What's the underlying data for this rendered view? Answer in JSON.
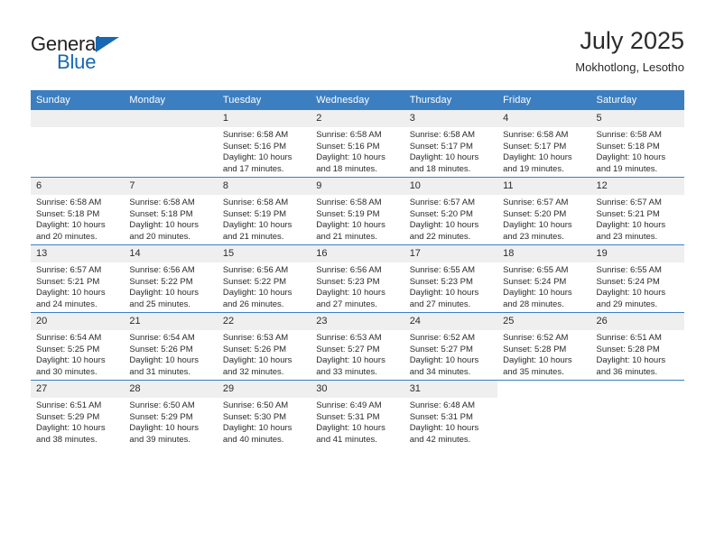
{
  "logo": {
    "word_primary": "General",
    "word_secondary": "Blue",
    "triangle_color": "#1668b3"
  },
  "header": {
    "title": "July 2025",
    "location": "Mokhotlong, Lesotho"
  },
  "theme": {
    "header_blue": "#3c7fc1",
    "daynum_gray": "#efefef",
    "text": "#2b2b2b"
  },
  "calendar": {
    "weekday_headers": [
      "Sunday",
      "Monday",
      "Tuesday",
      "Wednesday",
      "Thursday",
      "Friday",
      "Saturday"
    ],
    "labels": {
      "sunrise": "Sunrise:",
      "sunset": "Sunset:",
      "daylight": "Daylight:"
    },
    "weeks": [
      [
        {
          "day": "",
          "sunrise": "",
          "sunset": "",
          "daylight": "",
          "empty": true
        },
        {
          "day": "",
          "sunrise": "",
          "sunset": "",
          "daylight": "",
          "empty": true
        },
        {
          "day": "1",
          "sunrise": "Sunrise: 6:58 AM",
          "sunset": "Sunset: 5:16 PM",
          "daylight": "Daylight: 10 hours and 17 minutes."
        },
        {
          "day": "2",
          "sunrise": "Sunrise: 6:58 AM",
          "sunset": "Sunset: 5:16 PM",
          "daylight": "Daylight: 10 hours and 18 minutes."
        },
        {
          "day": "3",
          "sunrise": "Sunrise: 6:58 AM",
          "sunset": "Sunset: 5:17 PM",
          "daylight": "Daylight: 10 hours and 18 minutes."
        },
        {
          "day": "4",
          "sunrise": "Sunrise: 6:58 AM",
          "sunset": "Sunset: 5:17 PM",
          "daylight": "Daylight: 10 hours and 19 minutes."
        },
        {
          "day": "5",
          "sunrise": "Sunrise: 6:58 AM",
          "sunset": "Sunset: 5:18 PM",
          "daylight": "Daylight: 10 hours and 19 minutes."
        }
      ],
      [
        {
          "day": "6",
          "sunrise": "Sunrise: 6:58 AM",
          "sunset": "Sunset: 5:18 PM",
          "daylight": "Daylight: 10 hours and 20 minutes."
        },
        {
          "day": "7",
          "sunrise": "Sunrise: 6:58 AM",
          "sunset": "Sunset: 5:18 PM",
          "daylight": "Daylight: 10 hours and 20 minutes."
        },
        {
          "day": "8",
          "sunrise": "Sunrise: 6:58 AM",
          "sunset": "Sunset: 5:19 PM",
          "daylight": "Daylight: 10 hours and 21 minutes."
        },
        {
          "day": "9",
          "sunrise": "Sunrise: 6:58 AM",
          "sunset": "Sunset: 5:19 PM",
          "daylight": "Daylight: 10 hours and 21 minutes."
        },
        {
          "day": "10",
          "sunrise": "Sunrise: 6:57 AM",
          "sunset": "Sunset: 5:20 PM",
          "daylight": "Daylight: 10 hours and 22 minutes."
        },
        {
          "day": "11",
          "sunrise": "Sunrise: 6:57 AM",
          "sunset": "Sunset: 5:20 PM",
          "daylight": "Daylight: 10 hours and 23 minutes."
        },
        {
          "day": "12",
          "sunrise": "Sunrise: 6:57 AM",
          "sunset": "Sunset: 5:21 PM",
          "daylight": "Daylight: 10 hours and 23 minutes."
        }
      ],
      [
        {
          "day": "13",
          "sunrise": "Sunrise: 6:57 AM",
          "sunset": "Sunset: 5:21 PM",
          "daylight": "Daylight: 10 hours and 24 minutes."
        },
        {
          "day": "14",
          "sunrise": "Sunrise: 6:56 AM",
          "sunset": "Sunset: 5:22 PM",
          "daylight": "Daylight: 10 hours and 25 minutes."
        },
        {
          "day": "15",
          "sunrise": "Sunrise: 6:56 AM",
          "sunset": "Sunset: 5:22 PM",
          "daylight": "Daylight: 10 hours and 26 minutes."
        },
        {
          "day": "16",
          "sunrise": "Sunrise: 6:56 AM",
          "sunset": "Sunset: 5:23 PM",
          "daylight": "Daylight: 10 hours and 27 minutes."
        },
        {
          "day": "17",
          "sunrise": "Sunrise: 6:55 AM",
          "sunset": "Sunset: 5:23 PM",
          "daylight": "Daylight: 10 hours and 27 minutes."
        },
        {
          "day": "18",
          "sunrise": "Sunrise: 6:55 AM",
          "sunset": "Sunset: 5:24 PM",
          "daylight": "Daylight: 10 hours and 28 minutes."
        },
        {
          "day": "19",
          "sunrise": "Sunrise: 6:55 AM",
          "sunset": "Sunset: 5:24 PM",
          "daylight": "Daylight: 10 hours and 29 minutes."
        }
      ],
      [
        {
          "day": "20",
          "sunrise": "Sunrise: 6:54 AM",
          "sunset": "Sunset: 5:25 PM",
          "daylight": "Daylight: 10 hours and 30 minutes."
        },
        {
          "day": "21",
          "sunrise": "Sunrise: 6:54 AM",
          "sunset": "Sunset: 5:26 PM",
          "daylight": "Daylight: 10 hours and 31 minutes."
        },
        {
          "day": "22",
          "sunrise": "Sunrise: 6:53 AM",
          "sunset": "Sunset: 5:26 PM",
          "daylight": "Daylight: 10 hours and 32 minutes."
        },
        {
          "day": "23",
          "sunrise": "Sunrise: 6:53 AM",
          "sunset": "Sunset: 5:27 PM",
          "daylight": "Daylight: 10 hours and 33 minutes."
        },
        {
          "day": "24",
          "sunrise": "Sunrise: 6:52 AM",
          "sunset": "Sunset: 5:27 PM",
          "daylight": "Daylight: 10 hours and 34 minutes."
        },
        {
          "day": "25",
          "sunrise": "Sunrise: 6:52 AM",
          "sunset": "Sunset: 5:28 PM",
          "daylight": "Daylight: 10 hours and 35 minutes."
        },
        {
          "day": "26",
          "sunrise": "Sunrise: 6:51 AM",
          "sunset": "Sunset: 5:28 PM",
          "daylight": "Daylight: 10 hours and 36 minutes."
        }
      ],
      [
        {
          "day": "27",
          "sunrise": "Sunrise: 6:51 AM",
          "sunset": "Sunset: 5:29 PM",
          "daylight": "Daylight: 10 hours and 38 minutes."
        },
        {
          "day": "28",
          "sunrise": "Sunrise: 6:50 AM",
          "sunset": "Sunset: 5:29 PM",
          "daylight": "Daylight: 10 hours and 39 minutes."
        },
        {
          "day": "29",
          "sunrise": "Sunrise: 6:50 AM",
          "sunset": "Sunset: 5:30 PM",
          "daylight": "Daylight: 10 hours and 40 minutes."
        },
        {
          "day": "30",
          "sunrise": "Sunrise: 6:49 AM",
          "sunset": "Sunset: 5:31 PM",
          "daylight": "Daylight: 10 hours and 41 minutes."
        },
        {
          "day": "31",
          "sunrise": "Sunrise: 6:48 AM",
          "sunset": "Sunset: 5:31 PM",
          "daylight": "Daylight: 10 hours and 42 minutes."
        },
        {
          "day": "",
          "sunrise": "",
          "sunset": "",
          "daylight": "",
          "blank": true
        },
        {
          "day": "",
          "sunrise": "",
          "sunset": "",
          "daylight": "",
          "blank": true
        }
      ]
    ]
  }
}
